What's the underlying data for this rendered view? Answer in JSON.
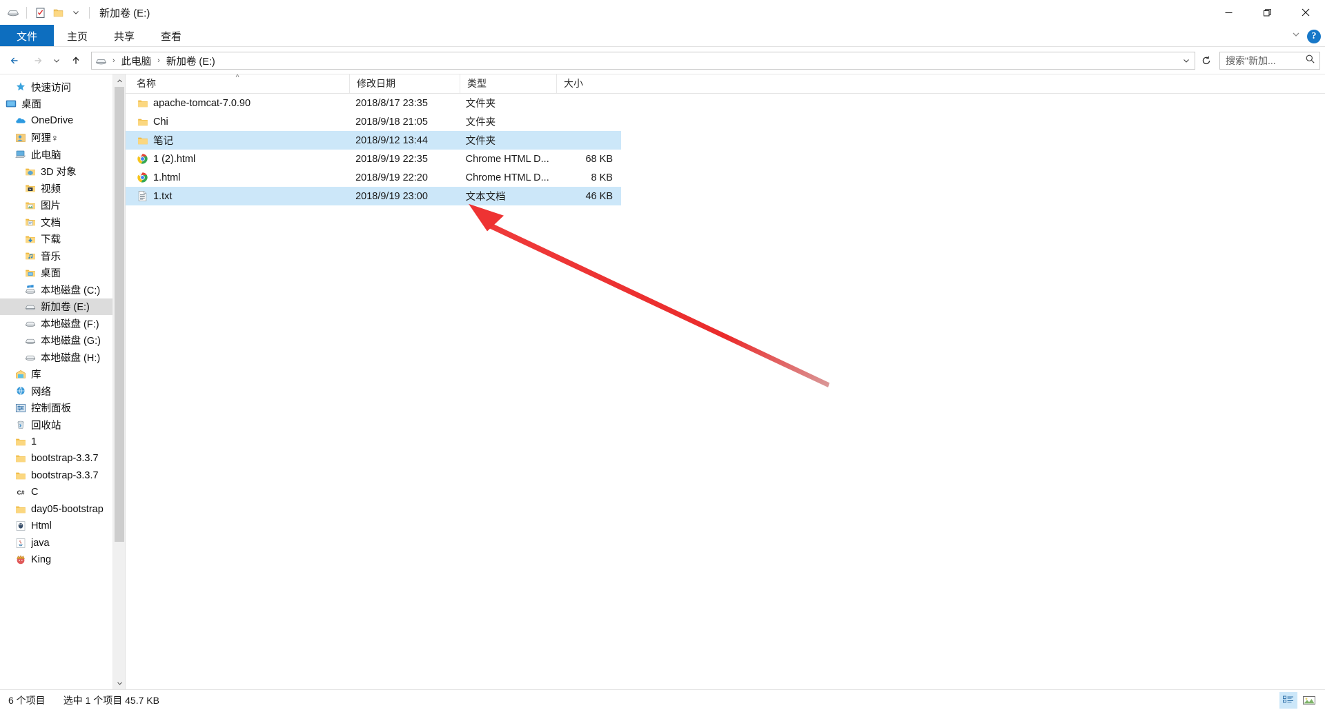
{
  "window": {
    "title": "新加卷 (E:)",
    "quick_access": [
      {
        "name": "drive-icon",
        "label": "新加卷 (E:)"
      },
      {
        "name": "properties-icon",
        "label": "属性"
      },
      {
        "name": "new-folder-icon",
        "label": "新建文件夹"
      },
      {
        "name": "customize-qat-chevron-icon",
        "label": "自定义快速访问工具栏"
      }
    ],
    "controls": {
      "minimize": "—",
      "maximize": "❐",
      "close": "✕"
    }
  },
  "ribbon": {
    "tabs": [
      {
        "label": "文件",
        "active": true
      },
      {
        "label": "主页",
        "active": false
      },
      {
        "label": "共享",
        "active": false
      },
      {
        "label": "查看",
        "active": false
      }
    ],
    "collapse_label": "˅",
    "help_label": "?"
  },
  "address": {
    "back": "←",
    "forward": "→",
    "recent": "˅",
    "up": "↑",
    "breadcrumbs": [
      "此电脑",
      "新加卷 (E:)"
    ],
    "separator": "›",
    "dropdown": "˅",
    "refresh_label": "↻",
    "search_placeholder": "搜索\"新加...",
    "search_value": "",
    "search_icon": "search-icon"
  },
  "navpane": {
    "items": [
      {
        "label": "快速访问",
        "icon": "star-icon",
        "indent": 1,
        "selected": false
      },
      {
        "label": "桌面",
        "icon": "desktop-icon",
        "indent": 0,
        "selected": false
      },
      {
        "label": "OneDrive",
        "icon": "onedrive-cloud-icon",
        "indent": 1,
        "selected": false
      },
      {
        "label": "阿狸♀",
        "icon": "user-icon",
        "indent": 1,
        "selected": false
      },
      {
        "label": "此电脑",
        "icon": "this-pc-icon",
        "indent": 1,
        "selected": false
      },
      {
        "label": "3D 对象",
        "icon": "folder-3d-icon",
        "indent": 2,
        "selected": false
      },
      {
        "label": "视频",
        "icon": "folder-video-icon",
        "indent": 2,
        "selected": false
      },
      {
        "label": "图片",
        "icon": "folder-pictures-icon",
        "indent": 2,
        "selected": false
      },
      {
        "label": "文档",
        "icon": "folder-documents-icon",
        "indent": 2,
        "selected": false
      },
      {
        "label": "下载",
        "icon": "folder-downloads-icon",
        "indent": 2,
        "selected": false
      },
      {
        "label": "音乐",
        "icon": "folder-music-icon",
        "indent": 2,
        "selected": false
      },
      {
        "label": "桌面",
        "icon": "folder-desktop-icon",
        "indent": 2,
        "selected": false
      },
      {
        "label": "本地磁盘 (C:)",
        "icon": "windows-drive-icon",
        "indent": 2,
        "selected": false
      },
      {
        "label": "新加卷 (E:)",
        "icon": "drive-icon",
        "indent": 2,
        "selected": true
      },
      {
        "label": "本地磁盘 (F:)",
        "icon": "drive-icon",
        "indent": 2,
        "selected": false
      },
      {
        "label": "本地磁盘 (G:)",
        "icon": "drive-icon",
        "indent": 2,
        "selected": false
      },
      {
        "label": "本地磁盘 (H:)",
        "icon": "drive-icon",
        "indent": 2,
        "selected": false
      },
      {
        "label": "库",
        "icon": "library-icon",
        "indent": 1,
        "selected": false
      },
      {
        "label": "网络",
        "icon": "network-icon",
        "indent": 1,
        "selected": false
      },
      {
        "label": "控制面板",
        "icon": "control-panel-icon",
        "indent": 1,
        "selected": false
      },
      {
        "label": "回收站",
        "icon": "recycle-bin-icon",
        "indent": 1,
        "selected": false
      },
      {
        "label": "1",
        "icon": "folder-icon",
        "indent": 1,
        "selected": false
      },
      {
        "label": "bootstrap-3.3.7",
        "icon": "folder-icon",
        "indent": 1,
        "selected": false
      },
      {
        "label": "bootstrap-3.3.7",
        "icon": "folder-icon",
        "indent": 1,
        "selected": false
      },
      {
        "label": "C",
        "icon": "csharp-icon",
        "indent": 1,
        "selected": false
      },
      {
        "label": "day05-bootstrap",
        "icon": "folder-icon",
        "indent": 1,
        "selected": false
      },
      {
        "label": "Html",
        "icon": "html-icon",
        "indent": 1,
        "selected": false
      },
      {
        "label": "java",
        "icon": "java-icon",
        "indent": 1,
        "selected": false
      },
      {
        "label": "King",
        "icon": "king-icon",
        "indent": 1,
        "selected": false
      }
    ],
    "scroll_up": "˄",
    "scroll_down": "˅"
  },
  "filelist": {
    "columns": [
      {
        "label": "名称",
        "key": "name",
        "sorted": "asc",
        "sort_glyph": "˄"
      },
      {
        "label": "修改日期",
        "key": "date",
        "sorted": ""
      },
      {
        "label": "类型",
        "key": "type",
        "sorted": ""
      },
      {
        "label": "大小",
        "key": "size",
        "sorted": ""
      }
    ],
    "rows": [
      {
        "name": "apache-tomcat-7.0.90",
        "date": "2018/8/17 23:35",
        "type": "文件夹",
        "size": "",
        "icon": "folder-icon",
        "selected": false
      },
      {
        "name": "Chi",
        "date": "2018/9/18 21:05",
        "type": "文件夹",
        "size": "",
        "icon": "folder-icon",
        "selected": false
      },
      {
        "name": "笔记",
        "date": "2018/9/12 13:44",
        "type": "文件夹",
        "size": "",
        "icon": "folder-icon",
        "selected": true
      },
      {
        "name": "1 (2).html",
        "date": "2018/9/19 22:35",
        "type": "Chrome HTML D...",
        "size": "68 KB",
        "icon": "chrome-icon",
        "selected": false
      },
      {
        "name": "1.html",
        "date": "2018/9/19 22:20",
        "type": "Chrome HTML D...",
        "size": "8 KB",
        "icon": "chrome-icon",
        "selected": false
      },
      {
        "name": "1.txt",
        "date": "2018/9/19 23:00",
        "type": "文本文档",
        "size": "46 KB",
        "icon": "text-file-icon",
        "selected": true
      }
    ]
  },
  "annotation": {
    "type": "arrow",
    "color": "#ee3333",
    "description": "红色箭头指向选中的笔记文件夹行"
  },
  "statusbar": {
    "count_text": "6 个项目",
    "selection_text": "选中 1 个项目  45.7 KB",
    "views": [
      {
        "name": "details-view-button",
        "label": "详细信息",
        "active": true
      },
      {
        "name": "large-icons-view-button",
        "label": "大图标",
        "active": false
      }
    ]
  },
  "colors": {
    "accent": "#0d6ebf",
    "selection": "#cce7f9",
    "nav_selection": "#dcdcdc",
    "annotation_red": "#ee3333"
  }
}
